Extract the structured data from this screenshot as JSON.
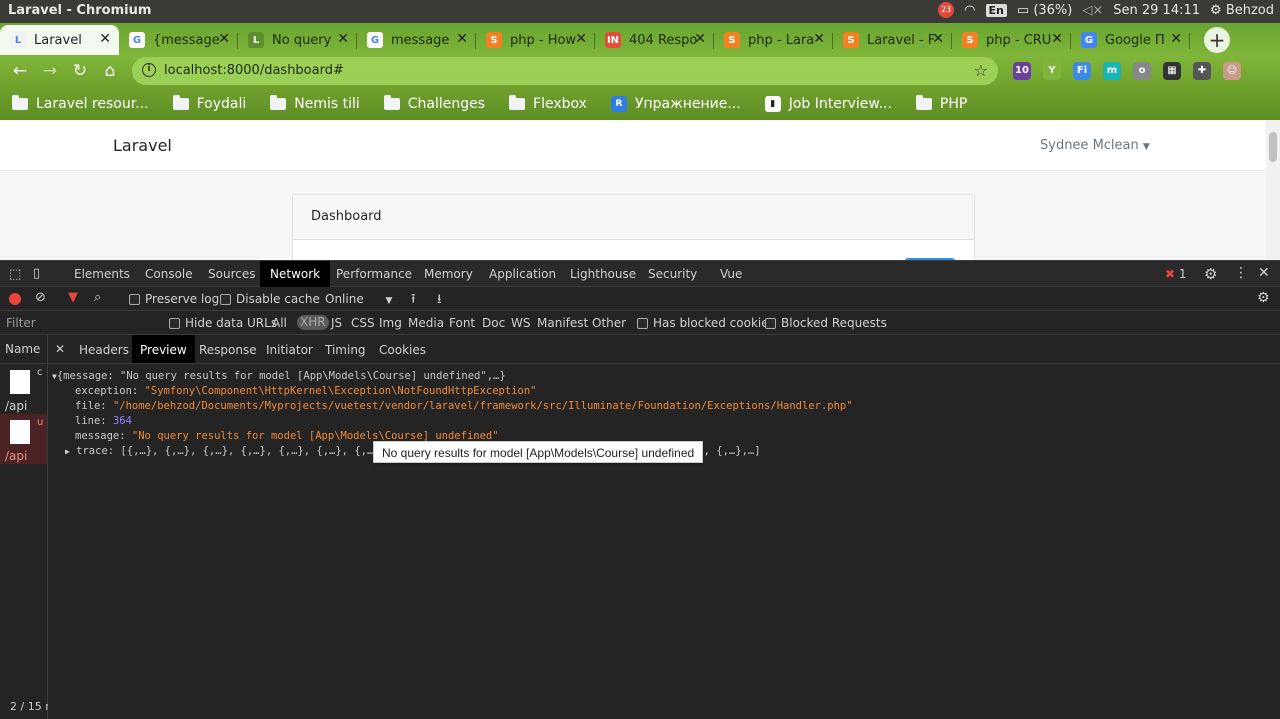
{
  "os": {
    "window_title": "Laravel - Chromium",
    "lang": "En",
    "battery": "(36%)",
    "datetime": "Sen 29 14:11",
    "user": "Behzod",
    "badge": "23"
  },
  "browser": {
    "tabs": [
      {
        "label": "Laravel",
        "icon": "L",
        "icon_color": "#f1f3f4",
        "active": true
      },
      {
        "label": "{message",
        "icon": "G",
        "icon_color": "#ffffff"
      },
      {
        "label": "No query",
        "icon": "L",
        "icon_color": "#5b8f2e"
      },
      {
        "label": "message",
        "icon": "G",
        "icon_color": "#ffffff"
      },
      {
        "label": "php - How",
        "icon": "S",
        "icon_color": "#f48024"
      },
      {
        "label": "404 Respo",
        "icon": "IN",
        "icon_color": "#e44d3a"
      },
      {
        "label": "php - Lara",
        "icon": "S",
        "icon_color": "#f48024"
      },
      {
        "label": "Laravel - F",
        "icon": "S",
        "icon_color": "#f48024"
      },
      {
        "label": "php - CRU",
        "icon": "S",
        "icon_color": "#f48024"
      },
      {
        "label": "Google П",
        "icon": "G",
        "icon_color": "#4285f4"
      }
    ],
    "url": "localhost:8000/dashboard#",
    "bookmarks": [
      {
        "label": "Laravel resour...",
        "type": "folder"
      },
      {
        "label": "Foydali",
        "type": "folder"
      },
      {
        "label": "Nemis tili",
        "type": "folder"
      },
      {
        "label": "Challenges",
        "type": "folder"
      },
      {
        "label": "Flexbox",
        "type": "folder"
      },
      {
        "label": "Упражнение...",
        "type": "icon",
        "color": "#2f7de1",
        "glyph": "R"
      },
      {
        "label": "Job Interview...",
        "type": "icon",
        "color": "#ffffff",
        "glyph": "▮"
      },
      {
        "label": "PHP",
        "type": "folder"
      }
    ],
    "extensions": [
      {
        "name": "graduation-cap-icon",
        "color": "#6b3fa0",
        "glyph": "10"
      },
      {
        "name": "y-extension-icon",
        "color": "#7fb63a",
        "glyph": "Y"
      },
      {
        "name": "fi-extension-icon",
        "color": "#3d8ae5",
        "glyph": "Fi"
      },
      {
        "name": "m-extension-icon",
        "color": "#19b6b6",
        "glyph": "m"
      },
      {
        "name": "circle-extension-icon",
        "color": "#888888",
        "glyph": "o"
      },
      {
        "name": "qr-extension-icon",
        "color": "#333333",
        "glyph": "▦"
      },
      {
        "name": "puzzle-icon",
        "color": "#555555",
        "glyph": "✚"
      },
      {
        "name": "profile-avatar-icon",
        "color": "#c79a8a",
        "glyph": "☺"
      }
    ]
  },
  "page": {
    "brand": "Laravel",
    "user": "Sydnee Mclean",
    "card_title": "Dashboard"
  },
  "devtools": {
    "tabs": [
      "Elements",
      "Console",
      "Sources",
      "Network",
      "Performance",
      "Memory",
      "Application",
      "Lighthouse",
      "Security",
      "Vue"
    ],
    "active_tab": "Network",
    "error_count": "1",
    "toolbar": {
      "preserve_log": "Preserve log",
      "disable_cache": "Disable cache",
      "throttle": "Online"
    },
    "filter": {
      "placeholder": "Filter",
      "hide_data_urls": "Hide data URLs",
      "types": [
        "All",
        "XHR",
        "JS",
        "CSS",
        "Img",
        "Media",
        "Font",
        "Doc",
        "WS",
        "Manifest",
        "Other"
      ],
      "active_type": "XHR",
      "blocked_cookies": "Has blocked cookies",
      "blocked_requests": "Blocked Requests"
    },
    "name_header": "Name",
    "requests": [
      {
        "name": "c",
        "path": "/api",
        "error": false
      },
      {
        "name": "u",
        "path": "/api",
        "error": true
      }
    ],
    "count": "2 / 15 r",
    "detail_tabs": [
      "Headers",
      "Preview",
      "Response",
      "Initiator",
      "Timing",
      "Cookies"
    ],
    "active_detail_tab": "Preview",
    "preview": {
      "summary": "{message: \"No query results for model [App\\Models\\Course] undefined\",…}",
      "exception_key": "exception:",
      "exception_val": "\"Symfony\\Component\\HttpKernel\\Exception\\NotFoundHttpException\"",
      "file_key": "file:",
      "file_val": "\"/home/behzod/Documents/Myprojects/vuetest/vendor/laravel/framework/src/Illuminate/Foundation/Exceptions/Handler.php\"",
      "line_key": "line:",
      "line_val": "364",
      "message_key": "message:",
      "message_val": "\"No query results for model [App\\Models\\Course] undefined\"",
      "trace_key": "trace:",
      "trace_val": "[{,…}, {,…}, {,…}, {,…}, {,…}, {,…}, {,…",
      "trace_tail": "…}, {,…},…]"
    },
    "tooltip": "No query results for model [App\\Models\\Course] undefined"
  }
}
